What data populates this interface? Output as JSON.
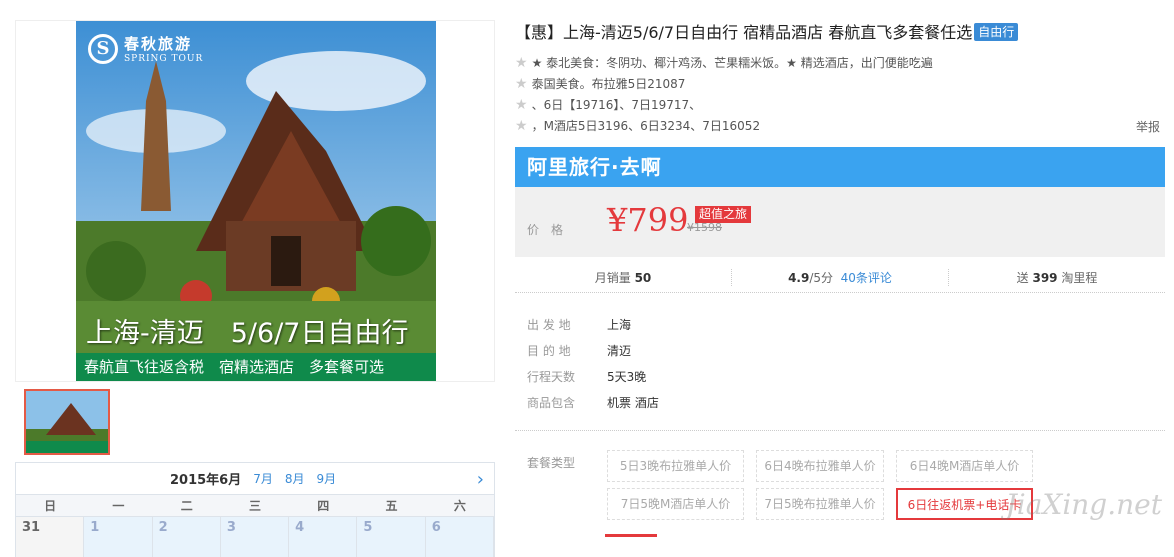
{
  "product": {
    "title": "【惠】上海-清迈5/6/7日自由行 宿精品酒店 春航直飞多套餐任选",
    "tag": "自由行",
    "highlights": [
      "★ 泰北美食：冬阴功、椰汁鸡汤、芒果糯米饭。★ 精选酒店，出门便能吃遍",
      "泰国美食。布拉雅5日21087",
      "、6日【19716】、7日19717、",
      "，M酒店5日3196、6日3234、7日16052"
    ],
    "report": "举报"
  },
  "image": {
    "logo_cn": "春秋旅游",
    "logo_en": "SPRING TOUR",
    "caption_title": "上海-清迈　5/6/7日自由行",
    "caption_band": "春航直飞往返含税　宿精选酒店　多套餐可选"
  },
  "banner": {
    "text": "阿里旅行·去啊"
  },
  "price": {
    "label": "价格",
    "current": "¥799",
    "original": "¥1598",
    "badge": "超值之旅"
  },
  "stats": {
    "sales_label": "月销量",
    "sales_value": "50",
    "rating_value": "4.9",
    "rating_suffix": "/5分",
    "reviews_link": "40条评论",
    "mileage_prefix": "送",
    "mileage_value": "399",
    "mileage_suffix": "淘里程"
  },
  "info": [
    {
      "key": "出 发 地",
      "value": "上海"
    },
    {
      "key": "目 的 地",
      "value": "清迈"
    },
    {
      "key": "行程天数",
      "value": "5天3晚"
    },
    {
      "key": "商品包含",
      "value": "机票 酒店"
    }
  ],
  "packages": {
    "label": "套餐类型",
    "options": [
      "5日3晚布拉雅单人价",
      "6日4晚布拉雅单人价",
      "6日4晚M酒店单人价",
      "7日5晚M酒店单人价",
      "7日5晚布拉雅单人价",
      "6日往返机票+电话卡"
    ],
    "selected_index": 5
  },
  "calendar": {
    "current": "2015年6月",
    "months": [
      "7月",
      "8月",
      "9月"
    ],
    "weekdays": [
      "日",
      "一",
      "二",
      "三",
      "四",
      "五",
      "六"
    ],
    "first_row": [
      "31",
      "1",
      "2",
      "3",
      "4",
      "5",
      "6"
    ]
  },
  "watermark": "JiaXing.net",
  "colors": {
    "accent_red": "#e4393c",
    "link_blue": "#3a8bd6",
    "banner_blue": "#3aa3f0",
    "band_green": "#0f8a4b"
  }
}
